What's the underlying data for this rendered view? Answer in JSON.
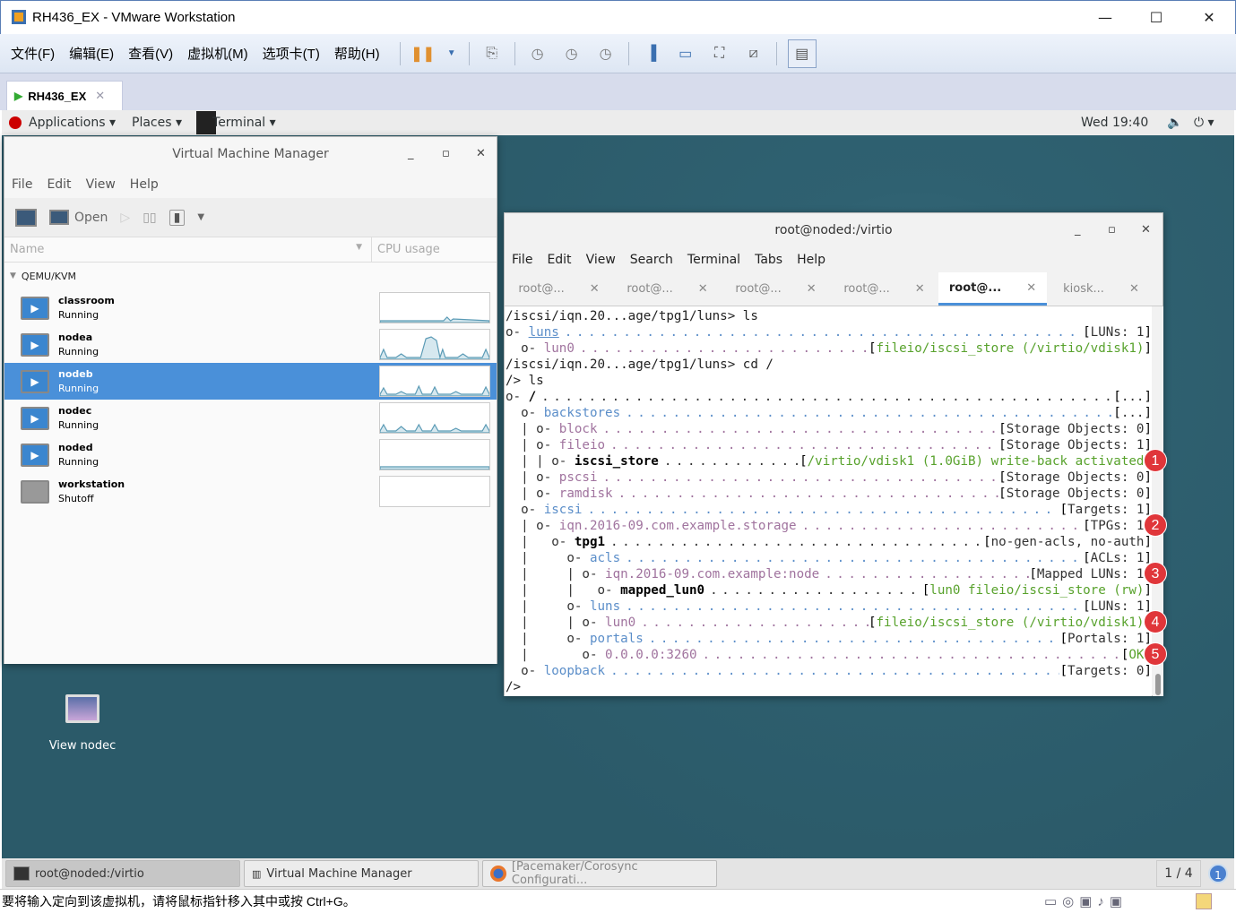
{
  "window": {
    "title": "RH436_EX - VMware Workstation",
    "min": "—",
    "max": "☐",
    "close": "✕"
  },
  "menu": [
    "文件(F)",
    "编辑(E)",
    "查看(V)",
    "虚拟机(M)",
    "选项卡(T)",
    "帮助(H)"
  ],
  "vm_tab": {
    "label": "RH436_EX",
    "close": "✕"
  },
  "gnome": {
    "applications": "Applications",
    "places": "Places",
    "terminal": "Terminal",
    "clock": "Wed 19:40"
  },
  "vmm": {
    "title": "Virtual Machine Manager",
    "menu": [
      "File",
      "Edit",
      "View",
      "Help"
    ],
    "open_label": "Open",
    "col_name": "Name",
    "col_cpu": "CPU usage",
    "group": "QEMU/KVM",
    "vms": [
      {
        "name": "classroom",
        "status": "Running"
      },
      {
        "name": "nodea",
        "status": "Running"
      },
      {
        "name": "nodeb",
        "status": "Running",
        "selected": true
      },
      {
        "name": "nodec",
        "status": "Running"
      },
      {
        "name": "noded",
        "status": "Running"
      },
      {
        "name": "workstation",
        "status": "Shutoff"
      }
    ]
  },
  "terminal": {
    "title": "root@noded:/virtio",
    "menu": [
      "File",
      "Edit",
      "View",
      "Search",
      "Terminal",
      "Tabs",
      "Help"
    ],
    "tabs": [
      "root@...",
      "root@...",
      "root@...",
      "root@...",
      "root@...",
      "kiosk..."
    ],
    "active_tab": 4,
    "lines": [
      {
        "text": "/iscsi/iqn.20...age/tpg1/luns> ls"
      },
      {
        "prefix": "o- ",
        "name": "luns",
        "color": "blueu",
        "value": "LUNs: 1",
        "vcolor": "def"
      },
      {
        "prefix": "  o- ",
        "name": "lun0",
        "color": "purple",
        "value": "fileio/iscsi_store (/virtio/vdisk1)",
        "vcolor": "green"
      },
      {
        "text": "/iscsi/iqn.20...age/tpg1/luns> cd /"
      },
      {
        "text": "/> ls"
      },
      {
        "prefix": "o- ",
        "name": "/",
        "color": "bold",
        "value": "...",
        "vcolor": "def"
      },
      {
        "prefix": "  o- ",
        "name": "backstores",
        "color": "blue",
        "value": "...",
        "vcolor": "def"
      },
      {
        "prefix": "  | o- ",
        "name": "block",
        "color": "purple",
        "value": "Storage Objects: 0",
        "vcolor": "def"
      },
      {
        "prefix": "  | o- ",
        "name": "fileio",
        "color": "purple",
        "value": "Storage Objects: 1",
        "vcolor": "def"
      },
      {
        "prefix": "  | | o- ",
        "name": "iscsi_store",
        "color": "bold",
        "value": "/virtio/vdisk1 (1.0GiB) write-back activated",
        "vcolor": "green"
      },
      {
        "prefix": "  | o- ",
        "name": "pscsi",
        "color": "purple",
        "value": "Storage Objects: 0",
        "vcolor": "def"
      },
      {
        "prefix": "  | o- ",
        "name": "ramdisk",
        "color": "purple",
        "value": "Storage Objects: 0",
        "vcolor": "def"
      },
      {
        "prefix": "  o- ",
        "name": "iscsi",
        "color": "blue",
        "value": "Targets: 1",
        "vcolor": "def"
      },
      {
        "prefix": "  | o- ",
        "name": "iqn.2016-09.com.example.storage",
        "color": "purple",
        "value": "TPGs: 1",
        "vcolor": "def"
      },
      {
        "prefix": "  |   o- ",
        "name": "tpg1",
        "color": "bold",
        "value": "no-gen-acls, no-auth",
        "vcolor": "def"
      },
      {
        "prefix": "  |     o- ",
        "name": "acls",
        "color": "blue",
        "value": "ACLs: 1",
        "vcolor": "def"
      },
      {
        "prefix": "  |     | o- ",
        "name": "iqn.2016-09.com.example:node",
        "color": "purple",
        "value": "Mapped LUNs: 1",
        "vcolor": "def"
      },
      {
        "prefix": "  |     |   o- ",
        "name": "mapped_lun0",
        "color": "bold",
        "value": "lun0 fileio/iscsi_store (rw)",
        "vcolor": "green"
      },
      {
        "prefix": "  |     o- ",
        "name": "luns",
        "color": "blue",
        "value": "LUNs: 1",
        "vcolor": "def"
      },
      {
        "prefix": "  |     | o- ",
        "name": "lun0",
        "color": "purple",
        "value": "fileio/iscsi_store (/virtio/vdisk1)",
        "vcolor": "green"
      },
      {
        "prefix": "  |     o- ",
        "name": "portals",
        "color": "blue",
        "value": "Portals: 1",
        "vcolor": "def"
      },
      {
        "prefix": "  |       o- ",
        "name": "0.0.0.0:3260",
        "color": "purple",
        "value": "OK",
        "vcolor": "green"
      },
      {
        "prefix": "  o- ",
        "name": "loopback",
        "color": "blue",
        "value": "Targets: 0",
        "vcolor": "def"
      },
      {
        "text": "/>"
      }
    ]
  },
  "badges": [
    {
      "n": "1",
      "line": 9
    },
    {
      "n": "2",
      "line": 13
    },
    {
      "n": "3",
      "line": 16
    },
    {
      "n": "4",
      "line": 19
    },
    {
      "n": "5",
      "line": 21
    }
  ],
  "desktop_icon": "View nodec",
  "taskbar": {
    "items": [
      "root@noded:/virtio",
      "Virtual Machine Manager",
      "[Pacemaker/Corosync Configurati..."
    ],
    "workspace": "1 / 4",
    "notif": "1"
  },
  "status_text": "要将输入定向到该虚拟机，请将鼠标指针移入其中或按 Ctrl+G。",
  "colors": {
    "desktop": "#2f6171",
    "selection": "#4a90d9",
    "badge": "#e0363a"
  }
}
